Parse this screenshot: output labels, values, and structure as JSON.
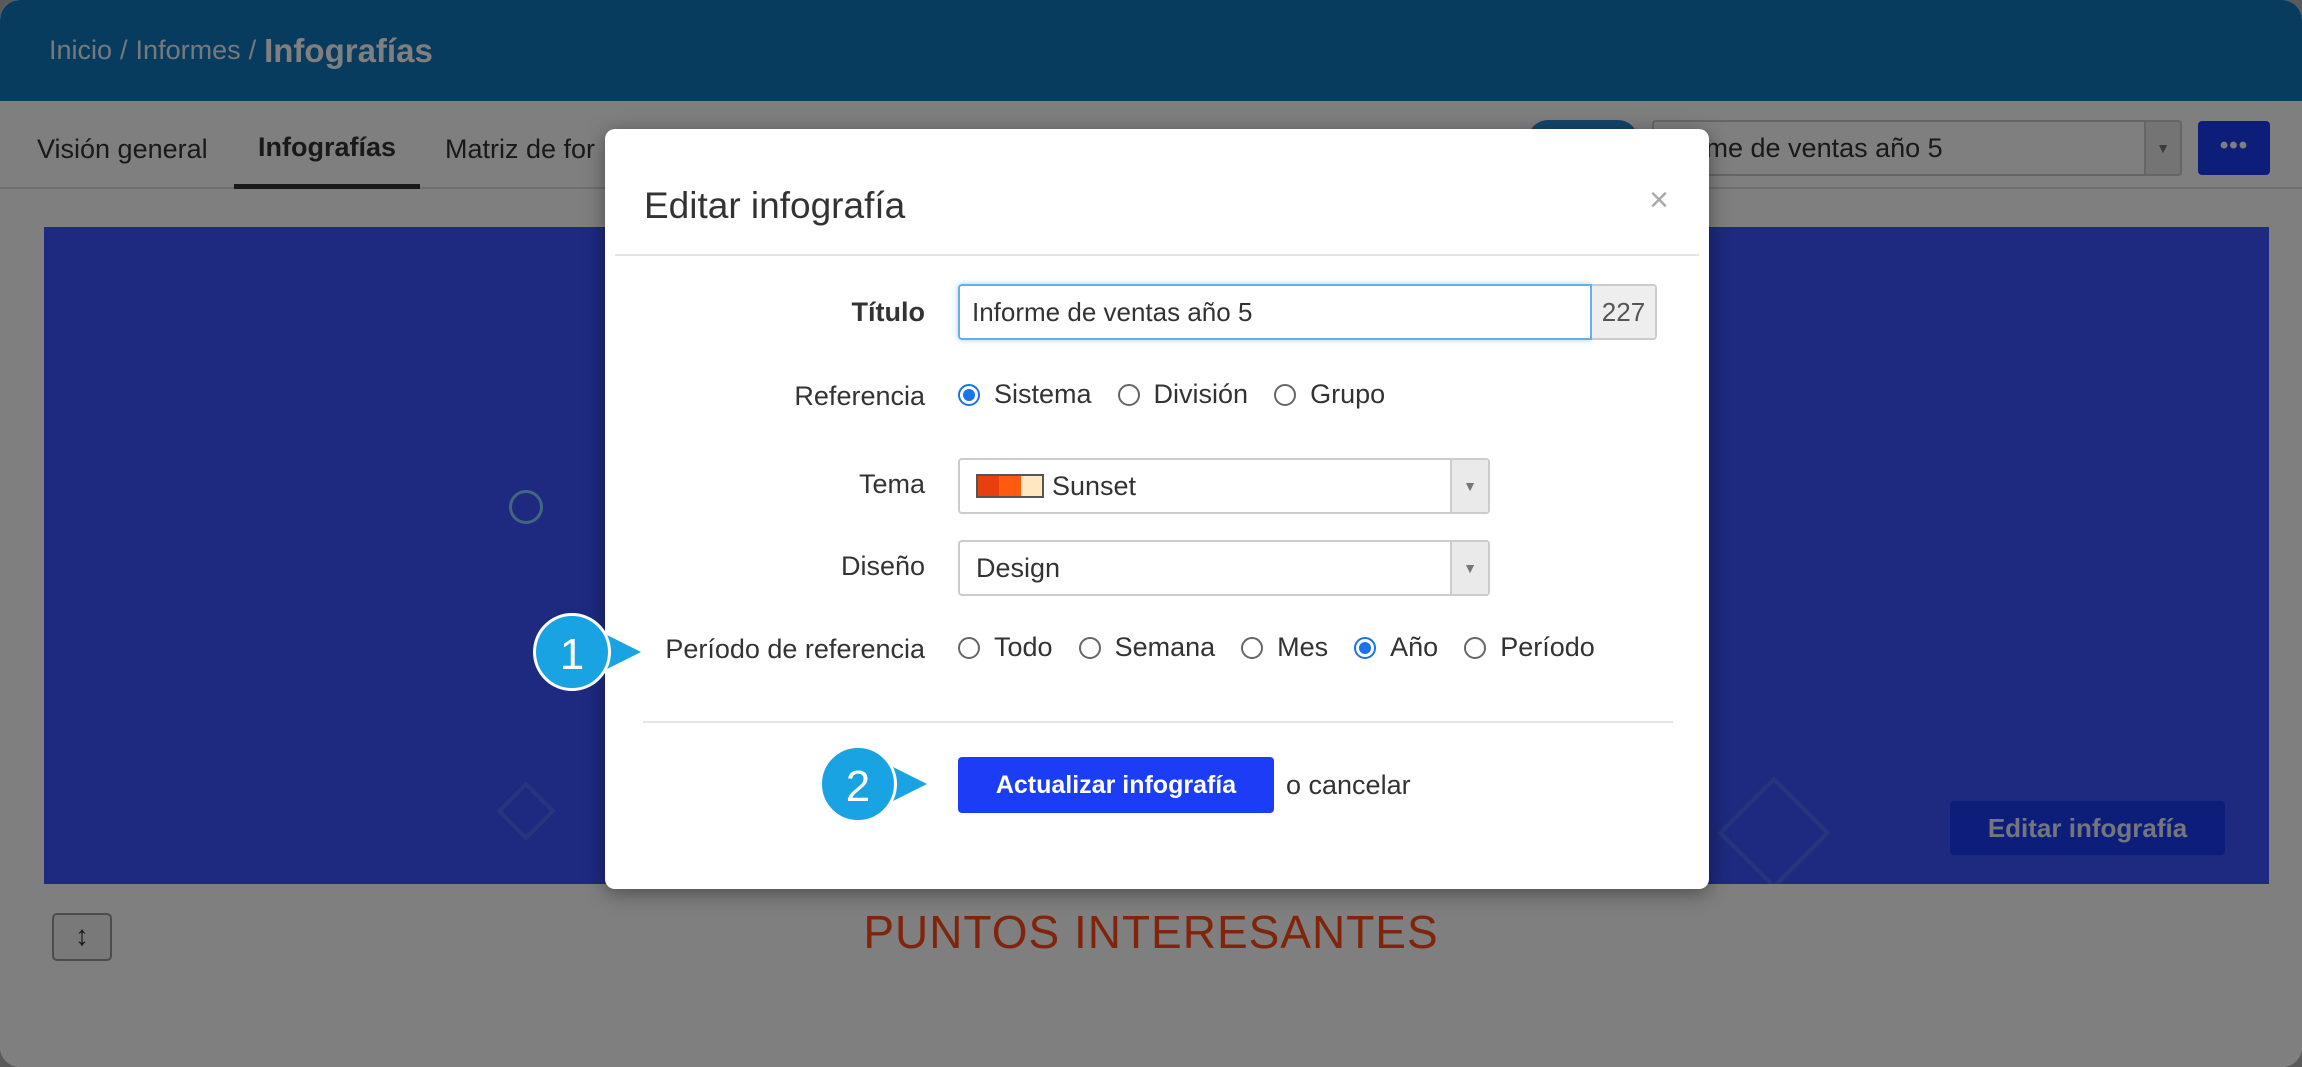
{
  "breadcrumb": {
    "home": "Inicio",
    "sep1": "/",
    "reports": "Informes",
    "sep2": "/",
    "current": "Infografías"
  },
  "tabs": {
    "overview": "Visión general",
    "infographics": "Infografías",
    "matrix": "Matriz de for"
  },
  "report_selector": {
    "value": "forme de ventas año 5",
    "arrow": "▼"
  },
  "more_button": {
    "label": "•••"
  },
  "canvas": {
    "edit_button": "Editar infografía",
    "heading": "PUNTOS INTERESANTES",
    "resize_icon": "↕"
  },
  "modal": {
    "title": "Editar infografía",
    "close": "×",
    "title_field": {
      "label": "Título",
      "value": "Informe de ventas año 5",
      "counter": "227"
    },
    "reference": {
      "label": "Referencia",
      "options": [
        "Sistema",
        "División",
        "Grupo"
      ],
      "selected": "Sistema"
    },
    "theme": {
      "label": "Tema",
      "value": "Sunset",
      "arrow": "▼",
      "colors": [
        "#e8400c",
        "#ff5a10",
        "#ffe8c0"
      ]
    },
    "design": {
      "label": "Diseño",
      "value": "Design",
      "arrow": "▼"
    },
    "period": {
      "label": "Período de referencia",
      "options": [
        "Todo",
        "Semana",
        "Mes",
        "Año",
        "Período"
      ],
      "selected": "Año"
    },
    "submit": "Actualizar infografía",
    "cancel": "o cancelar"
  },
  "callouts": {
    "one": "1",
    "two": "2"
  },
  "colors": {
    "brand_blue": "#1b3df5",
    "top_bar": "#1178bd",
    "callout": "#19a3e3",
    "heading": "#ff4a1c"
  }
}
